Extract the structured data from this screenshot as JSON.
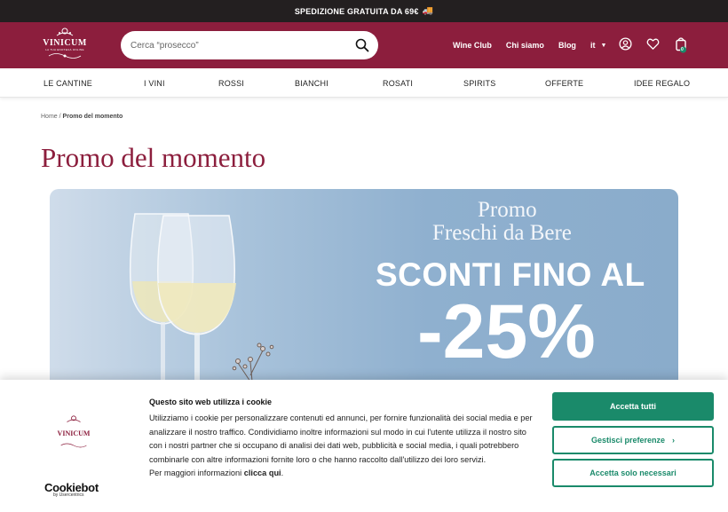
{
  "topbar": {
    "text": "SPEDIZIONE GRATUITA DA 69€",
    "icon": "truck-icon"
  },
  "header": {
    "logo": {
      "name": "VINICUM",
      "tagline": "LA TUA ENOTECA ONLINE"
    },
    "search": {
      "placeholder": "Cerca “prosecco”"
    },
    "links": {
      "wine_club": "Wine Club",
      "chi_siamo": "Chi siamo",
      "blog": "Blog",
      "lang": "it"
    },
    "cart_count": "0",
    "brand_color": "#8c1e3d"
  },
  "category_nav": [
    "LE CANTINE",
    "I VINI",
    "ROSSI",
    "BIANCHI",
    "ROSATI",
    "SPIRITS",
    "OFFERTE",
    "IDEE REGALO"
  ],
  "breadcrumb": {
    "home": "Home",
    "separator": "/",
    "current": "Promo del momento"
  },
  "page_title": "Promo del momento",
  "banner": {
    "line1": "Promo",
    "line2": "Freschi da Bere",
    "headline": "SCONTI FINO AL",
    "discount": "-25%"
  },
  "cookie": {
    "title": "Questo sito web utilizza i cookie",
    "body": "Utilizziamo i cookie per personalizzare contenuti ed annunci, per fornire funzionalità dei social media e per analizzare il nostro traffico. Condividiamo inoltre informazioni sul modo in cui l'utente utilizza il nostro sito con i nostri partner che si occupano di analisi dei dati web, pubblicità e social media, i quali potrebbero combinarle con altre informazioni fornite loro o che hanno raccolto dall'utilizzo dei loro servizi.",
    "more_prefix": "Per maggiori informazioni",
    "more_link": "clicca qui",
    "more_suffix": ".",
    "logo_name": "VINICUM",
    "cookiebot": "Cookiebot",
    "cookiebot_by": "by Usercentrics",
    "btn_accept_all": "Accetta tutti",
    "btn_preferences": "Gestisci preferenze",
    "btn_necessary": "Accetta solo necessari",
    "accent_color": "#1a8a6a"
  }
}
